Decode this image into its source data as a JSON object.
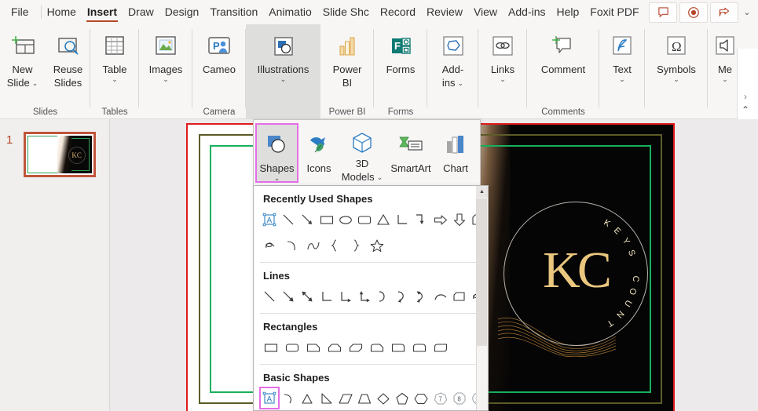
{
  "app": {
    "tabs": [
      {
        "id": "file",
        "label": "File",
        "active": false
      },
      {
        "id": "home",
        "label": "Home",
        "active": false
      },
      {
        "id": "insert",
        "label": "Insert",
        "active": true
      },
      {
        "id": "draw",
        "label": "Draw",
        "active": false
      },
      {
        "id": "design",
        "label": "Design",
        "active": false
      },
      {
        "id": "transitions",
        "label": "Transition",
        "active": false
      },
      {
        "id": "animations",
        "label": "Animatio",
        "active": false
      },
      {
        "id": "slideshow",
        "label": "Slide Shc",
        "active": false
      },
      {
        "id": "record",
        "label": "Record",
        "active": false
      },
      {
        "id": "review",
        "label": "Review",
        "active": false
      },
      {
        "id": "view",
        "label": "View",
        "active": false
      },
      {
        "id": "addins",
        "label": "Add-ins",
        "active": false
      },
      {
        "id": "help",
        "label": "Help",
        "active": false
      },
      {
        "id": "foxit",
        "label": "Foxit PDF",
        "active": false
      }
    ],
    "title_buttons": [
      {
        "name": "comments-button",
        "icon": "comment-icon"
      },
      {
        "name": "record-button",
        "icon": "record-icon"
      },
      {
        "name": "share-button",
        "icon": "share-icon"
      }
    ],
    "share_chevron": "⌄",
    "ribbon_more": "›",
    "ribbon_collapse": "⌃",
    "accent_color": "#b7472a",
    "highlight_color": "#e46ee6"
  },
  "ribbon": {
    "groups": [
      {
        "name": "Slides",
        "label": "Slides",
        "buttons": [
          {
            "label": "New\nSlide",
            "line1": "New",
            "line2": "Slide",
            "icon": "new-slide-icon",
            "chevron": "⌄",
            "inline_chevron": true
          },
          {
            "label": "Reuse\nSlides",
            "line1": "Reuse",
            "line2": "Slides",
            "icon": "reuse-slides-icon",
            "chevron": "",
            "inline_chevron": false
          }
        ]
      },
      {
        "name": "Tables",
        "label": "Tables",
        "buttons": [
          {
            "line1": "Table",
            "line2": "",
            "icon": "table-icon",
            "chevron": "⌄",
            "inline_chevron": false
          }
        ]
      },
      {
        "name": "Images",
        "label": "",
        "buttons": [
          {
            "line1": "Images",
            "line2": "",
            "icon": "images-icon",
            "chevron": "⌄",
            "inline_chevron": false
          }
        ]
      },
      {
        "name": "Camera",
        "label": "Camera",
        "buttons": [
          {
            "line1": "Cameo",
            "line2": "",
            "icon": "cameo-icon",
            "chevron": "",
            "inline_chevron": false
          }
        ]
      },
      {
        "name": "Illustrations",
        "label": "",
        "selected": true,
        "buttons": [
          {
            "line1": "Illustrations",
            "line2": "",
            "icon": "illustrations-icon",
            "chevron": "⌄",
            "inline_chevron": false
          }
        ]
      },
      {
        "name": "Power BI",
        "label": "Power BI",
        "buttons": [
          {
            "line1": "Power",
            "line2": "BI",
            "icon": "power-bi-icon",
            "chevron": "",
            "inline_chevron": false
          }
        ]
      },
      {
        "name": "Forms",
        "label": "Forms",
        "buttons": [
          {
            "line1": "Forms",
            "line2": "",
            "icon": "forms-icon",
            "chevron": "",
            "inline_chevron": false
          }
        ]
      },
      {
        "name": "Add-ins",
        "label": "",
        "buttons": [
          {
            "line1": "Add-",
            "line2": "ins",
            "icon": "addins-icon",
            "chevron": "⌄",
            "inline_chevron": true
          }
        ]
      },
      {
        "name": "Links",
        "label": "",
        "buttons": [
          {
            "line1": "Links",
            "line2": "",
            "icon": "links-icon",
            "chevron": "⌄",
            "inline_chevron": false
          }
        ]
      },
      {
        "name": "Comments",
        "label": "Comments",
        "buttons": [
          {
            "line1": "Comment",
            "line2": "",
            "icon": "comment-new-icon",
            "chevron": "",
            "inline_chevron": false
          }
        ]
      },
      {
        "name": "Text",
        "label": "",
        "buttons": [
          {
            "line1": "Text",
            "line2": "",
            "icon": "text-icon",
            "chevron": "⌄",
            "inline_chevron": false
          }
        ]
      },
      {
        "name": "Symbols",
        "label": "",
        "buttons": [
          {
            "line1": "Symbols",
            "line2": "",
            "icon": "symbols-icon",
            "chevron": "⌄",
            "inline_chevron": false
          }
        ]
      },
      {
        "name": "Media",
        "label": "",
        "buttons": [
          {
            "line1": "Me",
            "line2": "",
            "icon": "media-icon",
            "chevron": "⌄",
            "inline_chevron": false
          }
        ]
      }
    ]
  },
  "illustrations_flyout": {
    "items": [
      {
        "label": "Shapes",
        "icon": "shapes-icon",
        "chevron": "⌄",
        "selected": true
      },
      {
        "label": "Icons",
        "icon": "icons-icon",
        "chevron": "",
        "selected": false
      },
      {
        "label": "3D",
        "label2": "Models",
        "icon": "3d-models-icon",
        "chevron": "⌄",
        "selected": false
      },
      {
        "label": "SmartArt",
        "icon": "smartart-icon",
        "chevron": "",
        "selected": false
      },
      {
        "label": "Chart",
        "icon": "chart-icon",
        "chevron": "",
        "selected": false
      }
    ]
  },
  "shapes_gallery": {
    "sections": [
      {
        "title": "Recently Used Shapes",
        "rows": [
          [
            "text-box",
            "line",
            "line-arrow",
            "rectangle",
            "oval",
            "rounded-rectangle",
            "isosceles-triangle",
            "elbow-connector",
            "elbow-arrow-connector",
            "right-arrow",
            "down-arrow",
            "flowchart-card"
          ],
          [
            "freeform-scribble",
            "arc",
            "curve",
            "left-brace",
            "right-brace",
            "star-5-point"
          ]
        ]
      },
      {
        "title": "Lines",
        "rows": [
          [
            "line",
            "line-arrow",
            "line-double-arrow",
            "elbow-connector",
            "elbow-arrow-connector",
            "elbow-double-arrow",
            "curved-connector",
            "curved-arrow-connector",
            "curved-double-arrow",
            "arc",
            "freeform-shape",
            "scribble"
          ]
        ]
      },
      {
        "title": "Rectangles",
        "rows": [
          [
            "rectangle",
            "rounded-rectangle",
            "snip-single-corner",
            "snip-same-side-corner",
            "snip-diagonal-corner",
            "snip-and-round-corner",
            "round-single-corner",
            "round-same-side-corner",
            "round-diagonal-corner"
          ]
        ]
      },
      {
        "title": "Basic Shapes",
        "rows": [
          [
            "text-box",
            "arc-pie",
            "isosceles-triangle",
            "right-triangle",
            "parallelogram",
            "trapezoid",
            "diamond",
            "pentagon",
            "hexagon",
            "heptagon",
            "octagon",
            "decagon"
          ]
        ]
      }
    ],
    "scroll": {
      "up_arrow": "▲"
    },
    "selected_shape": "text-box"
  },
  "thumbnails": {
    "slides": [
      {
        "number": "1",
        "selected": true
      }
    ]
  },
  "slide": {
    "logo": {
      "arc_text": "KEYS COUNT",
      "monogram": "KC"
    },
    "border_colors": {
      "outer_selection": "#e01b1b",
      "olive": "#5d5c28",
      "green": "#17b05c"
    },
    "background": "#050505"
  }
}
